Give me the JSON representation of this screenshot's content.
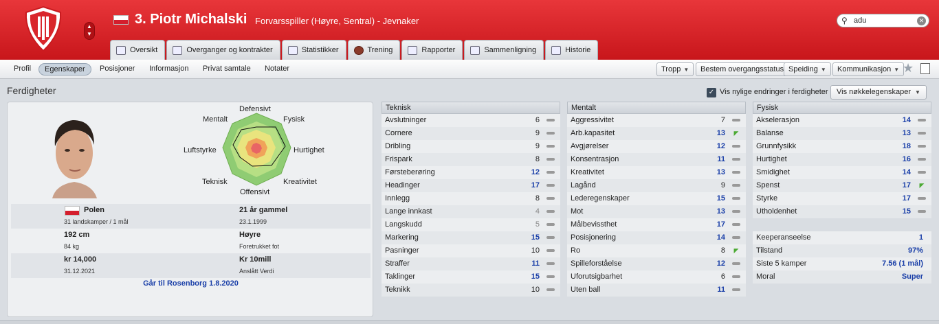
{
  "header": {
    "player_name": "3. Piotr Michalski",
    "description": "Forvarsspiller (Høyre, Sentral) - Jevnaker",
    "search_value": "adu",
    "colors": {
      "header_red": "#d9262b",
      "link_blue": "#1a3fa8"
    }
  },
  "tabs": [
    {
      "label": "Oversikt",
      "icon": "overview-icon"
    },
    {
      "label": "Overganger og kontrakter",
      "icon": "document-icon"
    },
    {
      "label": "Statistikker",
      "icon": "stats-icon"
    },
    {
      "label": "Trening",
      "icon": "ball-icon"
    },
    {
      "label": "Rapporter",
      "icon": "report-icon"
    },
    {
      "label": "Sammenligning",
      "icon": "compare-icon"
    },
    {
      "label": "Historie",
      "icon": "history-icon"
    }
  ],
  "subnav": [
    "Profil",
    "Egenskaper",
    "Posisjoner",
    "Informasjon",
    "Privat samtale",
    "Notater"
  ],
  "actions": [
    "Tropp",
    "Bestem overgangsstatus",
    "Speiding",
    "Kommunikasjon"
  ],
  "section_title": "Ferdigheter",
  "show_changes_label": "Vis nylige endringer i ferdigheter",
  "key_attributes_label": "Vis nøkkelegenskaper",
  "radar_labels": {
    "top": "Defensivt",
    "top_left": "Mentalt",
    "top_right": "Fysisk",
    "left": "Luftstyrke",
    "right": "Hurtighet",
    "bottom_left": "Teknisk",
    "bottom_right": "Kreativitet",
    "bottom": "Offensivt"
  },
  "info": {
    "nation": "Polen",
    "caps": "31 landskamper / 1 mål",
    "age": "21 år gammel",
    "dob": "23.1.1999",
    "height": "192 cm",
    "weight": "84 kg",
    "foot": "Høyre",
    "foot_label": "Foretrukket fot",
    "wage": "kr 14,000",
    "contract_end": "31.12.2021",
    "value": "Kr 10mill",
    "value_label": "Anslått Verdi",
    "transfer": "Går til Rosenborg 1.8.2020"
  },
  "technical": {
    "title": "Teknisk",
    "rows": [
      {
        "name": "Avslutninger",
        "value": "6",
        "trend": "flat",
        "tone": "normal"
      },
      {
        "name": "Cornere",
        "value": "9",
        "trend": "flat",
        "tone": "normal"
      },
      {
        "name": "Dribling",
        "value": "9",
        "trend": "flat",
        "tone": "normal"
      },
      {
        "name": "Frispark",
        "value": "8",
        "trend": "flat",
        "tone": "normal"
      },
      {
        "name": "Førsteberøring",
        "value": "12",
        "trend": "flat",
        "tone": "hi"
      },
      {
        "name": "Headinger",
        "value": "17",
        "trend": "flat",
        "tone": "hi"
      },
      {
        "name": "Innlegg",
        "value": "8",
        "trend": "flat",
        "tone": "normal"
      },
      {
        "name": "Lange innkast",
        "value": "4",
        "trend": "flat",
        "tone": "lo"
      },
      {
        "name": "Langskudd",
        "value": "5",
        "trend": "flat",
        "tone": "lo"
      },
      {
        "name": "Markering",
        "value": "15",
        "trend": "flat",
        "tone": "hi"
      },
      {
        "name": "Pasninger",
        "value": "10",
        "trend": "flat",
        "tone": "normal"
      },
      {
        "name": "Straffer",
        "value": "11",
        "trend": "flat",
        "tone": "hi"
      },
      {
        "name": "Taklinger",
        "value": "15",
        "trend": "flat",
        "tone": "hi"
      },
      {
        "name": "Teknikk",
        "value": "10",
        "trend": "flat",
        "tone": "normal"
      }
    ]
  },
  "mental": {
    "title": "Mentalt",
    "rows": [
      {
        "name": "Aggressivitet",
        "value": "7",
        "trend": "flat",
        "tone": "normal"
      },
      {
        "name": "Arb.kapasitet",
        "value": "13",
        "trend": "up",
        "tone": "hi"
      },
      {
        "name": "Avgjørelser",
        "value": "12",
        "trend": "flat",
        "tone": "hi"
      },
      {
        "name": "Konsentrasjon",
        "value": "11",
        "trend": "flat",
        "tone": "hi"
      },
      {
        "name": "Kreativitet",
        "value": "13",
        "trend": "flat",
        "tone": "hi"
      },
      {
        "name": "Lagånd",
        "value": "9",
        "trend": "flat",
        "tone": "normal"
      },
      {
        "name": "Lederegenskaper",
        "value": "15",
        "trend": "flat",
        "tone": "hi"
      },
      {
        "name": "Mot",
        "value": "13",
        "trend": "flat",
        "tone": "hi"
      },
      {
        "name": "Målbevissthet",
        "value": "17",
        "trend": "flat",
        "tone": "hi"
      },
      {
        "name": "Posisjonering",
        "value": "14",
        "trend": "flat",
        "tone": "hi"
      },
      {
        "name": "Ro",
        "value": "8",
        "trend": "up",
        "tone": "normal"
      },
      {
        "name": "Spilleforståelse",
        "value": "12",
        "trend": "flat",
        "tone": "hi"
      },
      {
        "name": "Uforutsigbarhet",
        "value": "6",
        "trend": "flat",
        "tone": "normal"
      },
      {
        "name": "Uten ball",
        "value": "11",
        "trend": "flat",
        "tone": "hi"
      }
    ]
  },
  "physical": {
    "title": "Fysisk",
    "rows": [
      {
        "name": "Akselerasjon",
        "value": "14",
        "trend": "flat",
        "tone": "hi"
      },
      {
        "name": "Balanse",
        "value": "13",
        "trend": "flat",
        "tone": "hi"
      },
      {
        "name": "Grunnfysikk",
        "value": "18",
        "trend": "flat",
        "tone": "hi"
      },
      {
        "name": "Hurtighet",
        "value": "16",
        "trend": "flat",
        "tone": "hi"
      },
      {
        "name": "Smidighet",
        "value": "14",
        "trend": "flat",
        "tone": "hi"
      },
      {
        "name": "Spenst",
        "value": "17",
        "trend": "up",
        "tone": "hi"
      },
      {
        "name": "Styrke",
        "value": "17",
        "trend": "flat",
        "tone": "hi"
      },
      {
        "name": "Utholdenhet",
        "value": "15",
        "trend": "flat",
        "tone": "hi"
      }
    ],
    "extra": [
      {
        "name": "Keeperanseelse",
        "value": "1"
      },
      {
        "name": "Tilstand",
        "value": "97%"
      },
      {
        "name": "Siste 5 kamper",
        "value": "7.56 (1 mål)"
      },
      {
        "name": "Moral",
        "value": "Super"
      }
    ]
  }
}
